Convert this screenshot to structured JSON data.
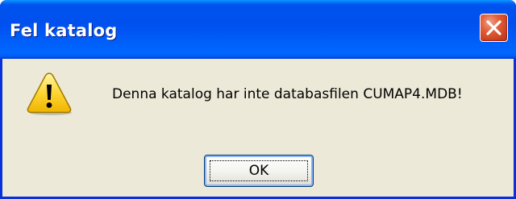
{
  "dialog": {
    "title": "Fel katalog",
    "message": "Denna katalog har inte databasfilen CUMAP4.MDB!",
    "ok_label": "OK",
    "icon": "warning-icon",
    "close_icon": "close-icon"
  },
  "colors": {
    "titlebar": "#0054e3",
    "frame": "#0831d9",
    "body_bg": "#ece9d8",
    "close_button": "#e2603c",
    "warning_yellow": "#fdd633"
  }
}
